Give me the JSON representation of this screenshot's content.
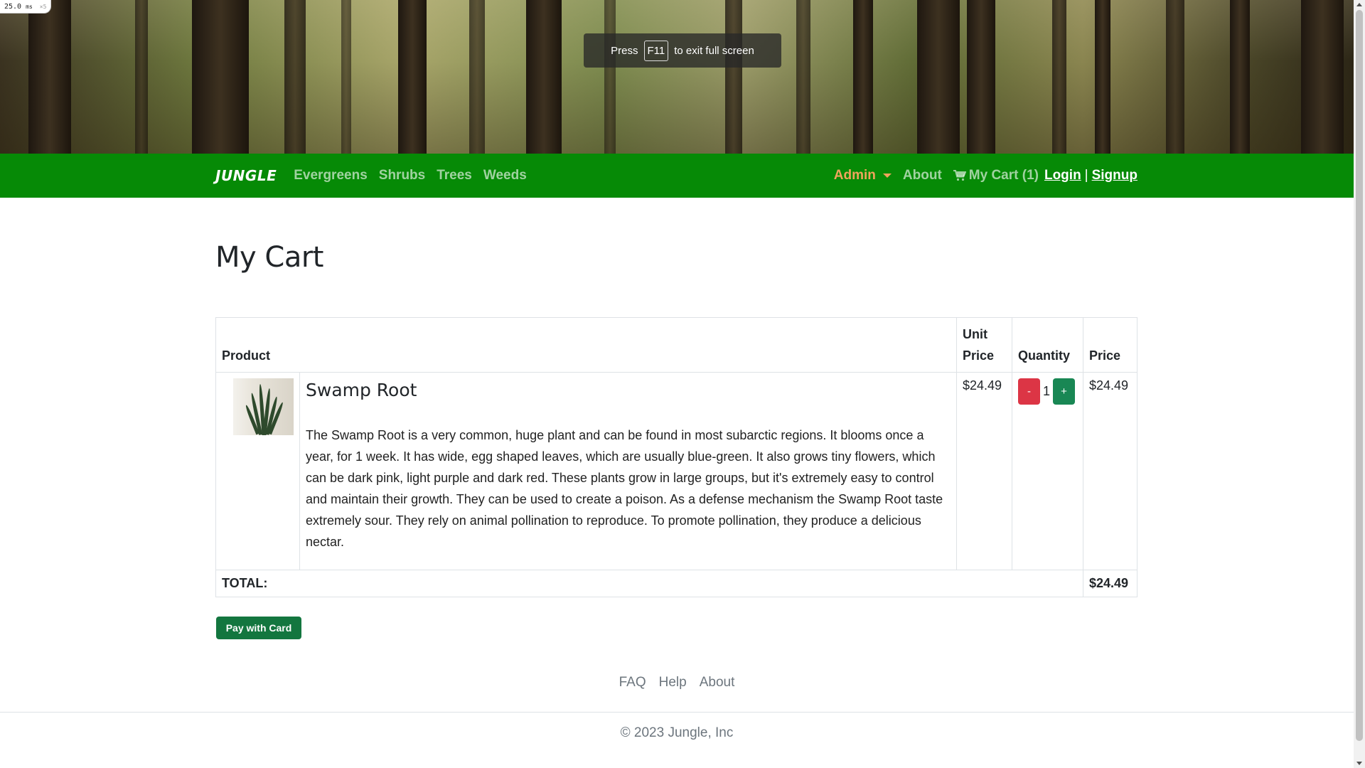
{
  "timing": {
    "value": "25.0",
    "unit": "ms",
    "sub": "×5"
  },
  "fullscreen_toast": {
    "press": "Press",
    "key": "F11",
    "message": "to exit full screen"
  },
  "nav": {
    "brand": "JUNGLE",
    "categories": [
      "Evergreens",
      "Shrubs",
      "Trees",
      "Weeds"
    ],
    "admin": "Admin",
    "about": "About",
    "cart": "My Cart (1)",
    "login": "Login",
    "separator": "|",
    "signup": "Signup"
  },
  "page": {
    "title": "My Cart"
  },
  "table": {
    "headers": {
      "product": "Product",
      "unit_price": "Unit Price",
      "quantity": "Quantity",
      "price": "Price"
    },
    "items": [
      {
        "name": "Swamp Root",
        "description": "The Swamp Root is a very common, huge plant and can be found in most subarctic regions. It blooms once a year, for 1 week. It has wide, egg shaped leaves, which are usually blue-green. It also grows tiny flowers, which can be dark pink, light purple and dark red. These plants grow in large groups, but it's extremely easy to control and maintain their growth. They can be used to create a poison. As a defense mechanism the Swamp Root taste extremely sour. They rely on animal pollination to reproduce. To promote pollination, they produce a delicious nectar.",
        "unit_price": "$24.49",
        "quantity": "1",
        "minus_label": "-",
        "plus_label": "+",
        "price": "$24.49"
      }
    ],
    "total_label": "TOTAL:",
    "total_value": "$24.49"
  },
  "pay_button": "Pay with Card",
  "footer": {
    "links": [
      "FAQ",
      "Help",
      "About"
    ],
    "copyright": "© 2023 Jungle, Inc"
  },
  "colors": {
    "navbar": "#068a06",
    "admin": "#f0a45c",
    "danger": "#dc3545",
    "success": "#198754"
  }
}
